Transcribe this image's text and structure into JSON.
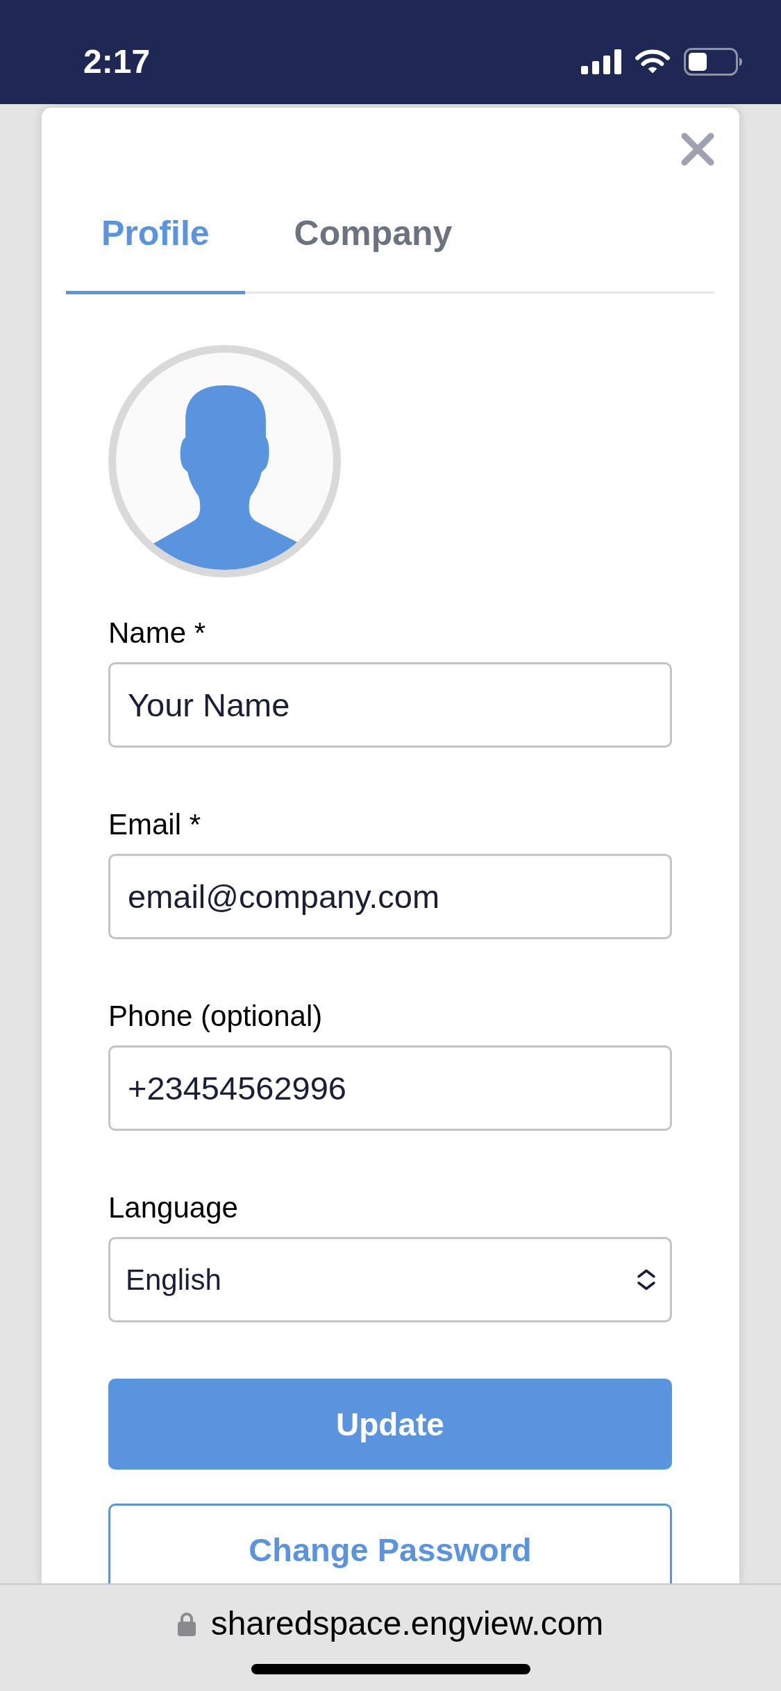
{
  "status_bar": {
    "time": "2:17"
  },
  "tabs": [
    {
      "label": "Profile",
      "selected": true
    },
    {
      "label": "Company",
      "selected": false
    }
  ],
  "form": {
    "fields": [
      {
        "kind": "text",
        "label": "Name *",
        "value": "Your Name"
      },
      {
        "kind": "text",
        "label": "Email *",
        "value": "email@company.com"
      },
      {
        "kind": "text",
        "label": "Phone (optional)",
        "value": "+23454562996"
      },
      {
        "kind": "select",
        "label": "Language",
        "value": "English"
      }
    ]
  },
  "buttons": [
    {
      "kind": "primary",
      "label": "Update"
    },
    {
      "kind": "outline",
      "label": "Change Password"
    }
  ],
  "browser_bar": {
    "url": "sharedspace.engview.com"
  }
}
